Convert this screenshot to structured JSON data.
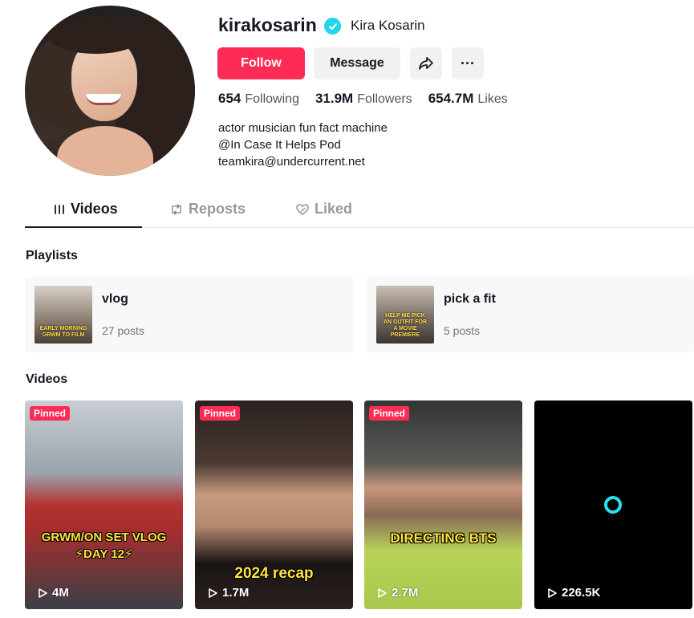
{
  "profile": {
    "username": "kirakosarin",
    "nickname": "Kira Kosarin",
    "verified_icon": "verified-badge-icon",
    "bio_lines": [
      "actor musician fun fact machine",
      "@In Case It Helps Pod",
      "teamkira@undercurrent.net"
    ]
  },
  "actions": {
    "follow_label": "Follow",
    "message_label": "Message",
    "share_icon": "share-arrow-icon",
    "more_label": "···"
  },
  "stats": {
    "following_count": "654",
    "following_label": "Following",
    "followers_count": "31.9M",
    "followers_label": "Followers",
    "likes_count": "654.7M",
    "likes_label": "Likes"
  },
  "tabs": [
    {
      "label": "Videos",
      "icon": "grid-icon",
      "active": true
    },
    {
      "label": "Reposts",
      "icon": "repost-icon",
      "active": false
    },
    {
      "label": "Liked",
      "icon": "heart-outline-icon",
      "active": false
    }
  ],
  "playlists": {
    "title": "Playlists",
    "items": [
      {
        "name": "vlog",
        "count": "27 posts",
        "thumb_caption": "EARLY MORNING GRWM TO FILM"
      },
      {
        "name": "pick a fit",
        "count": "5 posts",
        "thumb_caption": "HELP ME PICK AN OUTFIT FOR A MOVIE PREMIERE"
      }
    ]
  },
  "videos": {
    "title": "Videos",
    "items": [
      {
        "pinned": "Pinned",
        "overlay": "GRWM/ON SET VLOG ⚡DAY 12⚡",
        "views": "4M"
      },
      {
        "pinned": "Pinned",
        "overlay": "2024 recap",
        "views": "1.7M"
      },
      {
        "pinned": "Pinned",
        "overlay": "DIRECTING BTS",
        "views": "2.7M"
      },
      {
        "pinned": "",
        "overlay": "",
        "views": "226.5K"
      }
    ]
  },
  "colors": {
    "accent": "#fe2c55",
    "verified": "#20d5ec",
    "loader": "#25e1f4"
  }
}
